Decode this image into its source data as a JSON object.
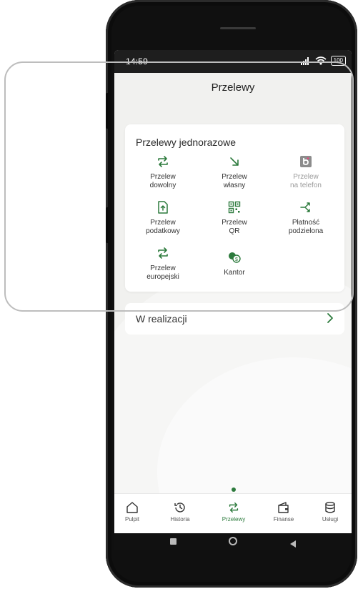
{
  "status_bar": {
    "time": "14:59",
    "battery": "100"
  },
  "header": {
    "title": "Przelewy"
  },
  "card": {
    "title": "Przelewy jednorazowe",
    "tiles": [
      {
        "line1": "Przelew",
        "line2": "dowolny",
        "icon": "transfer-arrows-icon",
        "enabled": true
      },
      {
        "line1": "Przelew",
        "line2": "własny",
        "icon": "arrow-down-right-icon",
        "enabled": true
      },
      {
        "line1": "Przelew",
        "line2": "na telefon",
        "icon": "blik-icon",
        "enabled": false
      },
      {
        "line1": "Przelew",
        "line2": "podatkowy",
        "icon": "tax-document-icon",
        "enabled": true
      },
      {
        "line1": "Przelew",
        "line2": "QR",
        "icon": "qr-code-icon",
        "enabled": true
      },
      {
        "line1": "Płatność",
        "line2": "podzielona",
        "icon": "split-payment-icon",
        "enabled": true
      },
      {
        "line1": "Przelew",
        "line2": "europejski",
        "icon": "transfer-arrows-icon",
        "enabled": true
      },
      {
        "line1": "Kantor",
        "line2": "",
        "icon": "currency-exchange-icon",
        "enabled": true
      }
    ]
  },
  "realizacji": {
    "label": "W realizacji"
  },
  "bottom_nav": {
    "items": [
      {
        "label": "Pulpit",
        "icon": "home-icon"
      },
      {
        "label": "Historia",
        "icon": "history-icon"
      },
      {
        "label": "Przelewy",
        "icon": "transfer-arrows-icon",
        "active": true
      },
      {
        "label": "Finanse",
        "icon": "wallet-icon"
      },
      {
        "label": "Usługi",
        "icon": "database-icon"
      }
    ]
  },
  "colors": {
    "accent": "#2c7a3c",
    "disabled": "#9a9a9a"
  }
}
